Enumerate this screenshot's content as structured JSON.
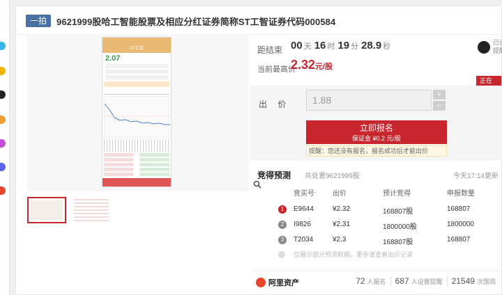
{
  "listing": {
    "tag": "一拍",
    "title": "9621999股哈工智能股票及相应分红证券简称ST工智证券代码000584"
  },
  "countdown": {
    "label": "距结束",
    "days": "00",
    "days_unit": "天",
    "hours": "16",
    "hours_unit": "时",
    "minutes": "19",
    "minutes_unit": "分",
    "seconds": "28.9",
    "seconds_unit": "秒"
  },
  "current_bid": {
    "label": "当前最高价",
    "value": "2.32",
    "unit": "元/股"
  },
  "reminder": {
    "line1": "已设",
    "line2": "提醒"
  },
  "status": "正在进行",
  "offer": {
    "label": "出 价",
    "value": "1.88",
    "plus": "+",
    "minus": "−"
  },
  "signup": {
    "label": "立即报名",
    "deposit": "保证金 ¥0.2 元/股"
  },
  "notice": "提醒：您还没有报名，报名成功后才能出价",
  "predict": {
    "title": "竞得预测",
    "subtitle": "共处置9621999股",
    "updated": "今天17:14更新",
    "headers": [
      "竞买号",
      "出价",
      "预计竞得",
      "申报数量"
    ],
    "rows": [
      {
        "rank": "1",
        "id": "E9644",
        "price": "¥2.32",
        "expected": "168807股",
        "declared": "168807"
      },
      {
        "rank": "2",
        "id": "I9826",
        "price": "¥2.31",
        "expected": "1800000股",
        "declared": "1800000"
      },
      {
        "rank": "3",
        "id": "T2034",
        "price": "¥2.3",
        "expected": "168807股",
        "declared": "168807"
      }
    ],
    "note": "仅展示部分预测数据，更多请查看出价记录"
  },
  "footer": {
    "brand": "阿里资产",
    "signups": "72",
    "signups_label": "人报名",
    "reminders": "687",
    "reminders_label": "人设置提醒",
    "views": "21549",
    "views_label": "次围观"
  },
  "phone_screen": {
    "title": "ST工智",
    "price": "2.07"
  },
  "colors": {
    "accent": "#c8262f",
    "tag": "#4a6fa5",
    "gain": "#39a04a"
  }
}
